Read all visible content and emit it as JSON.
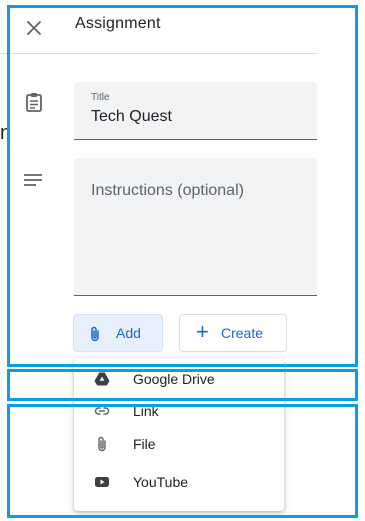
{
  "cut_text": "n",
  "header": {
    "title": "Assignment"
  },
  "form": {
    "title_label": "Title",
    "title_value": "Tech Quest",
    "instructions_placeholder": "Instructions (optional)"
  },
  "buttons": {
    "add": "Add",
    "create": "Create",
    "create_symbol": "+"
  },
  "menu": {
    "items": [
      {
        "label": "Google Drive",
        "icon": "google-drive-icon"
      },
      {
        "label": "Link",
        "icon": "link-icon"
      },
      {
        "label": "File",
        "icon": "paperclip-icon"
      },
      {
        "label": "YouTube",
        "icon": "youtube-icon"
      }
    ]
  },
  "colors": {
    "accent": "#1967d2",
    "field_bg": "#f1f3f4",
    "annotation_box": "#0a9ee5"
  }
}
